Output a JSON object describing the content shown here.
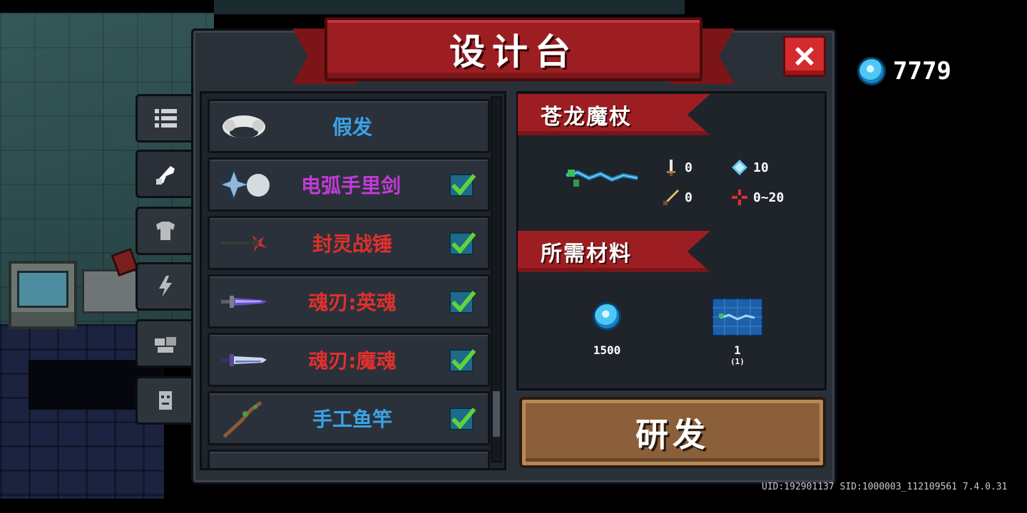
{
  "window": {
    "title": "设计台"
  },
  "currency": {
    "icon": "blue-gem-icon",
    "amount": "7779"
  },
  "side_tabs": [
    {
      "icon": "list-icon"
    },
    {
      "icon": "weapon-icon"
    },
    {
      "icon": "armor-icon"
    },
    {
      "icon": "lightning-icon"
    },
    {
      "icon": "material-icon"
    },
    {
      "icon": "pet-icon"
    }
  ],
  "list": {
    "items": [
      {
        "name": "假发",
        "color": "#3aa3e8",
        "icon": "wig-icon",
        "checked": false
      },
      {
        "name": "电弧手里剑",
        "color": "#c23bd6",
        "icon": "shuriken-icon",
        "checked": true
      },
      {
        "name": "封灵战锤",
        "color": "#e0302c",
        "icon": "war-hammer-icon",
        "checked": true
      },
      {
        "name": "魂刃:英魂",
        "color": "#e0302c",
        "icon": "soul-blade-icon",
        "checked": true
      },
      {
        "name": "魂刃:魔魂",
        "color": "#e0302c",
        "icon": "demon-blade-icon",
        "checked": true
      },
      {
        "name": "手工鱼竿",
        "color": "#3aa3e8",
        "icon": "fishing-rod-icon",
        "checked": true
      }
    ]
  },
  "detail": {
    "weapon_name": "苍龙魔杖",
    "stats": {
      "damage": "0",
      "energy": "10",
      "crit": "0",
      "spread": "0~20"
    },
    "materials_title": "所需材料",
    "materials": [
      {
        "icon": "blue-gem-icon",
        "count": "1500",
        "sub": ""
      },
      {
        "icon": "blueprint-icon",
        "count": "1",
        "sub": "(1)"
      }
    ]
  },
  "research_button": "研发",
  "footer": {
    "uid_text": "UID:192901137 SID:1000003_112109561 7.4.0.31"
  }
}
